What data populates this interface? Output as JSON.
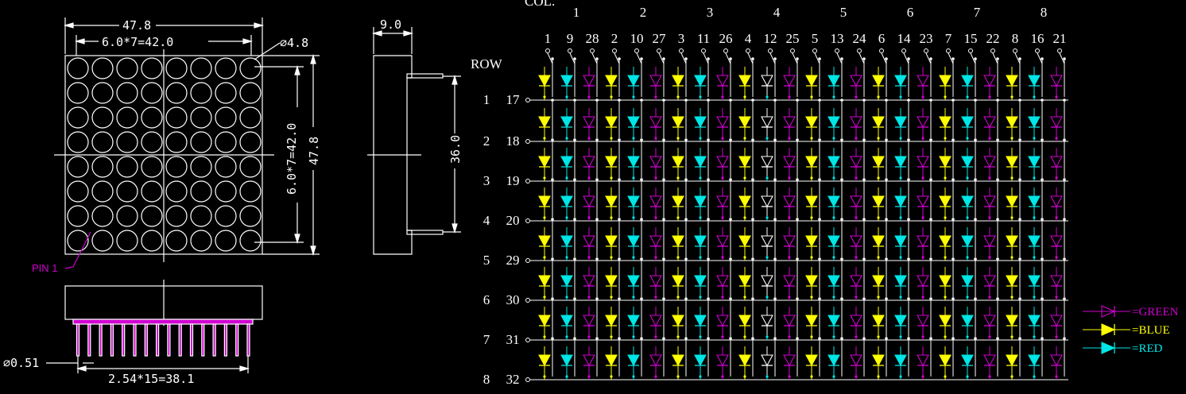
{
  "front_view": {
    "width_label": "47.8",
    "pitch_label": "6.0*7=42.0",
    "dot_label": "⌀4.8",
    "vpitch_label": "6.0*7=42.0",
    "height_label": "47.8",
    "pin1_label": "PIN 1"
  },
  "bottom_view": {
    "pin_dia_label": "⌀0.51",
    "pin_pitch_label": "2.54*15=38.1"
  },
  "side_view": {
    "depth_label": "9.0",
    "pin_span_label": "36.0"
  },
  "schematic": {
    "col_header": "COL.",
    "row_header": "ROW",
    "columns": [
      "1",
      "2",
      "3",
      "4",
      "5",
      "6",
      "7",
      "8"
    ],
    "column_pins": [
      [
        "1",
        "9",
        "28"
      ],
      [
        "2",
        "10",
        "27"
      ],
      [
        "3",
        "11",
        "26"
      ],
      [
        "4",
        "12",
        "25"
      ],
      [
        "5",
        "13",
        "24"
      ],
      [
        "6",
        "14",
        "23"
      ],
      [
        "7",
        "15",
        "22"
      ],
      [
        "8",
        "16",
        "21"
      ]
    ],
    "rows": [
      {
        "row": "1",
        "pin": "17"
      },
      {
        "row": "2",
        "pin": "18"
      },
      {
        "row": "3",
        "pin": "19"
      },
      {
        "row": "4",
        "pin": "20"
      },
      {
        "row": "5",
        "pin": "29"
      },
      {
        "row": "6",
        "pin": "30"
      },
      {
        "row": "7",
        "pin": "31"
      },
      {
        "row": "8",
        "pin": "32"
      }
    ]
  },
  "legend": [
    {
      "label": "=GREEN",
      "color": "#d000d0",
      "filled": false
    },
    {
      "label": "=BLUE",
      "color": "#ffff00",
      "filled": true
    },
    {
      "label": "=RED",
      "color": "#00e5e5",
      "filled": true
    }
  ],
  "colors": {
    "yellow": "#ffff00",
    "cyan": "#00e5e5",
    "magenta": "#d000d0",
    "white": "#ffffff"
  }
}
